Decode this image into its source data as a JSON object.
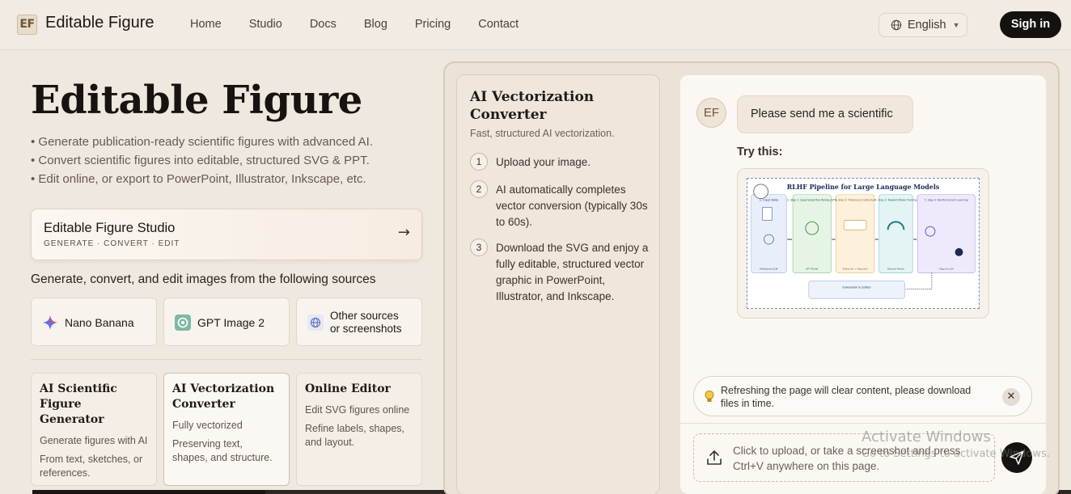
{
  "header": {
    "logo_text": "EF",
    "brand": "Editable Figure",
    "nav": [
      "Home",
      "Studio",
      "Docs",
      "Blog",
      "Pricing",
      "Contact"
    ],
    "language": "English",
    "signin": "Sigh in"
  },
  "hero": {
    "title": "Editable Figure",
    "bullets": [
      "• Generate publication-ready scientific figures with advanced AI.",
      "• Convert scientific figures into editable, structured SVG & PPT.",
      "• Edit online, or export to PowerPoint, Illustrator, Inkscape, etc."
    ]
  },
  "studio_card": {
    "title": "Editable Figure Studio",
    "subtitle": "GENERATE · CONVERT · EDIT",
    "arrow": "→"
  },
  "sources": {
    "label": "Generate, convert, and edit images from the following sources",
    "items": [
      {
        "label": "Nano Banana",
        "icon": "sparkle-icon"
      },
      {
        "label": "GPT Image 2",
        "icon": "openai-icon"
      },
      {
        "label_line1": "Other sources",
        "label_line2": "or screenshots",
        "icon": "globe-icon"
      }
    ]
  },
  "tools": [
    {
      "title": "AI Scientific Figure Generator",
      "desc1": "Generate figures with AI",
      "desc2": "From text, sketches, or references."
    },
    {
      "title": "AI Vectorization Converter",
      "desc1": "Fully vectorized",
      "desc2": "Preserving text, shapes, and structure."
    },
    {
      "title": "Online Editor",
      "desc1": "Edit SVG figures online",
      "desc2": "Refine labels, shapes, and layout."
    }
  ],
  "converter": {
    "title": "AI Vectorization Converter",
    "subtitle": "Fast, structured AI vectorization.",
    "steps": [
      {
        "n": "1",
        "text": "Upload your image."
      },
      {
        "n": "2",
        "text": "AI automatically completes vector conversion (typically 30s to 60s)."
      },
      {
        "n": "3",
        "text": "Download the SVG and enjoy a fully editable, structured vector graphic in PowerPoint, Illustrator, and Inkscape."
      }
    ]
  },
  "chat": {
    "avatar": "EF",
    "message": "Please send me a scientific",
    "try_label": "Try this:",
    "figure": {
      "title": "RLHF Pipeline for Large Language Models",
      "columns": [
        "1. Input Data",
        "2. Step 1: Supervised Fine-Tuning (SFT)",
        "3. Step 2: Preference Collection",
        "4. Step 3: Reward Model Training",
        "5. Step 4: Reinforcement Learning"
      ],
      "footers": [
        "Pretrained LLM",
        "SFT Model",
        "Preferred > Rejected",
        "Reward Model",
        "Aligned LLM"
      ],
      "eval": "Evaluation & Safety"
    },
    "notice": "Refreshing the page will clear content, please download files in time.",
    "upload_text": "Click to upload, or take a screenshot and press Ctrl+V anywhere on this page."
  },
  "watermark": {
    "line1": "Activate Windows",
    "line2": "Go to Settings to activate Windows."
  },
  "colors": {
    "background": "#efe8df",
    "accent_dark": "#15110e",
    "card": "#f8f3ed"
  }
}
